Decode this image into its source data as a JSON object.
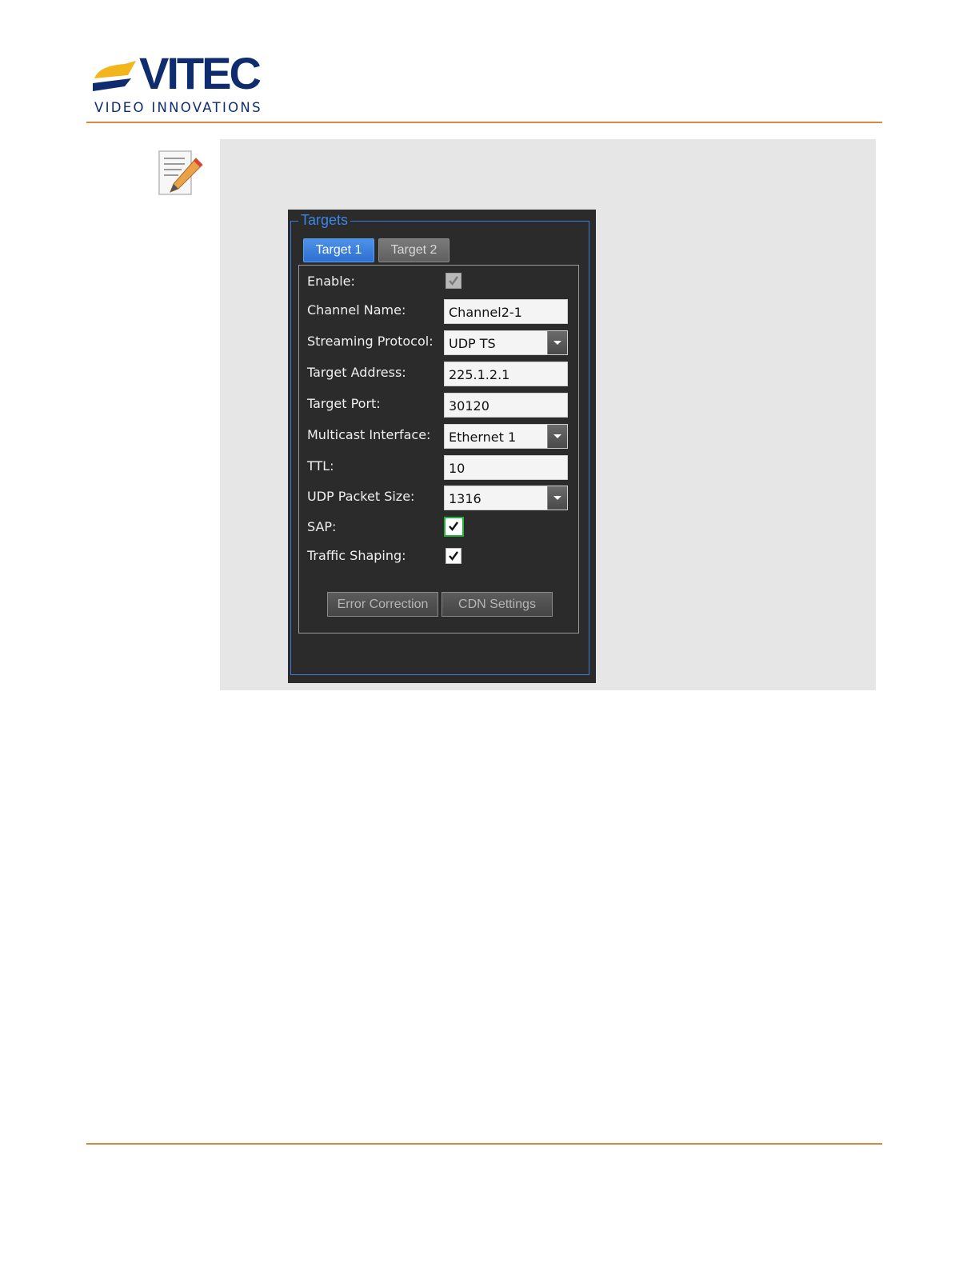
{
  "header": {
    "logo_text": "VITEC",
    "tagline": "VIDEO INNOVATIONS"
  },
  "note": {
    "icon": "note-pencil-icon"
  },
  "screenshot": {
    "group_title": "Targets",
    "tabs": [
      {
        "label": "Target 1",
        "active": true
      },
      {
        "label": "Target 2",
        "active": false
      }
    ],
    "fields": {
      "enable": {
        "label": "Enable:",
        "checked": true,
        "disabled": true
      },
      "channel_name": {
        "label": "Channel Name:",
        "value": "Channel2-1"
      },
      "streaming_protocol": {
        "label": "Streaming Protocol:",
        "value": "UDP TS"
      },
      "target_address": {
        "label": "Target Address:",
        "value": "225.1.2.1"
      },
      "target_port": {
        "label": "Target Port:",
        "value": "30120"
      },
      "multicast_interface": {
        "label": "Multicast Interface:",
        "value": "Ethernet 1"
      },
      "ttl": {
        "label": "TTL:",
        "value": "10"
      },
      "udp_packet_size": {
        "label": "UDP Packet Size:",
        "value": "1316"
      },
      "sap": {
        "label": "SAP:",
        "checked": true,
        "focused": true
      },
      "traffic_shaping": {
        "label": "Traffic Shaping:",
        "checked": true
      }
    },
    "buttons": {
      "error_correction": "Error Correction",
      "cdn_settings": "CDN Settings"
    }
  },
  "colors": {
    "brand_navy": "#0f2d6e",
    "brand_yellow": "#f2b51c",
    "rule_orange": "#d8873f",
    "accent_blue": "#3a86e8",
    "focus_green": "#22b33a"
  }
}
